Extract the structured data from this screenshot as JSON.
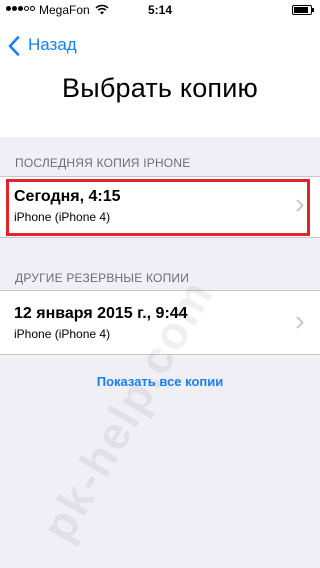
{
  "status_bar": {
    "carrier": "MegaFon",
    "time": "5:14",
    "signal_bars_filled": 3,
    "signal_bars_total": 5,
    "battery_level": 0.9
  },
  "nav": {
    "back_label": "Назад",
    "back_icon": "chevron-left-icon"
  },
  "page": {
    "title": "Выбрать копию"
  },
  "last_backup": {
    "header": "ПОСЛЕДНЯЯ КОПИЯ IPHONE",
    "items": [
      {
        "title": "Сегодня, 4:15",
        "subtitle": "iPhone (iPhone 4)"
      }
    ]
  },
  "other_backups": {
    "header": "ДРУГИЕ РЕЗЕРВНЫЕ КОПИИ",
    "items": [
      {
        "title": "12 января 2015 г., 9:44",
        "subtitle": "iPhone (iPhone 4)"
      }
    ]
  },
  "show_all_label": "Показать все копии",
  "watermark": "pk-help.com",
  "colors": {
    "accent": "#157efb",
    "highlight": "#e3252b",
    "group_background": "#f0eff5",
    "section_header": "#6d6d72"
  }
}
